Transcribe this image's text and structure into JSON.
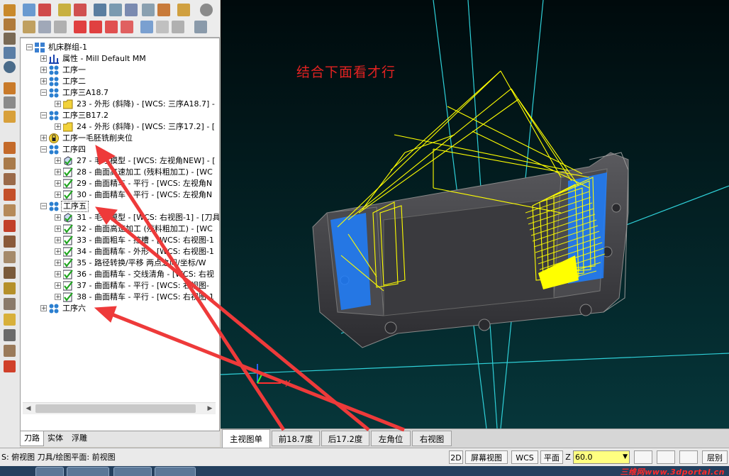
{
  "tree": {
    "root": "机床群组-1",
    "properties": "属性 - Mill Default MM",
    "op1": "工序一",
    "op2": "工序二",
    "op3a": "工序三A18.7",
    "op3a_child": "23 - 外形 (斜降) - [WCS: 三序A18.7] -",
    "op3b": "工序三B17.2",
    "op3b_child": "24 - 外形 (斜降) - [WCS: 三序17.2] - [",
    "op1_fixture": "工序一毛胚铣削夹位",
    "op4": "工序四",
    "op4_items": [
      "27 - 毛坯模型 - [WCS: 左视角NEW] - [",
      "28 - 曲面高速加工 (残料粗加工) - [WC",
      "29 - 曲面精车 - 平行 - [WCS: 左视角N",
      "30 - 曲面精车 - 平行 - [WCS: 左视角N"
    ],
    "op5": "工序五",
    "op5_items": [
      "31 - 毛坯模型 - [WCS: 右视图-1] - [刀具",
      "32 - 曲面高速加工 (残料粗加工) - [WC",
      "33 - 曲面粗车 - 挖槽 - [WCS: 右视图-1",
      "34 - 曲面精车 - 外形 - [WCS: 右视图-1",
      "35 - 路径转换/平移 两点之间/坐标/W",
      "36 - 曲面精车 - 交线清角 - [WCS: 右视",
      "37 - 曲面精车 - 平行 - [WCS: 右视图-",
      "38 - 曲面精车 - 平行 - [WCS: 右视图-1"
    ],
    "op6": "工序六"
  },
  "left_tabs": [
    "刀路",
    "实体",
    "浮雕"
  ],
  "viewport": {
    "annotation": "结合下面看才行",
    "axis_x": "X",
    "accent_toolpath": "#ffff00",
    "accent_selection": "#1e7fff"
  },
  "view_tabs": [
    "主视图单",
    "前18.7度",
    "后17.2度",
    "左角位",
    "右视图"
  ],
  "status": {
    "left_text": "S: 俯视图  刀具/绘图平面: 前视图",
    "btn_2d": "2D",
    "btn_screen_view": "屏幕视图",
    "btn_wcs": "WCS",
    "btn_plane": "平面",
    "z_label": "Z",
    "z_value": "60.0",
    "layer_label": "层别"
  },
  "watermark": "三维网www.3dportal.cn",
  "colors": {
    "arrow_red": "#ee3a3a",
    "annotation_red": "#e32222",
    "checkmark_green": "#1fa51f",
    "op_icon_blue": "#2b7fd0",
    "z_field_yellow": "#ffff80"
  }
}
